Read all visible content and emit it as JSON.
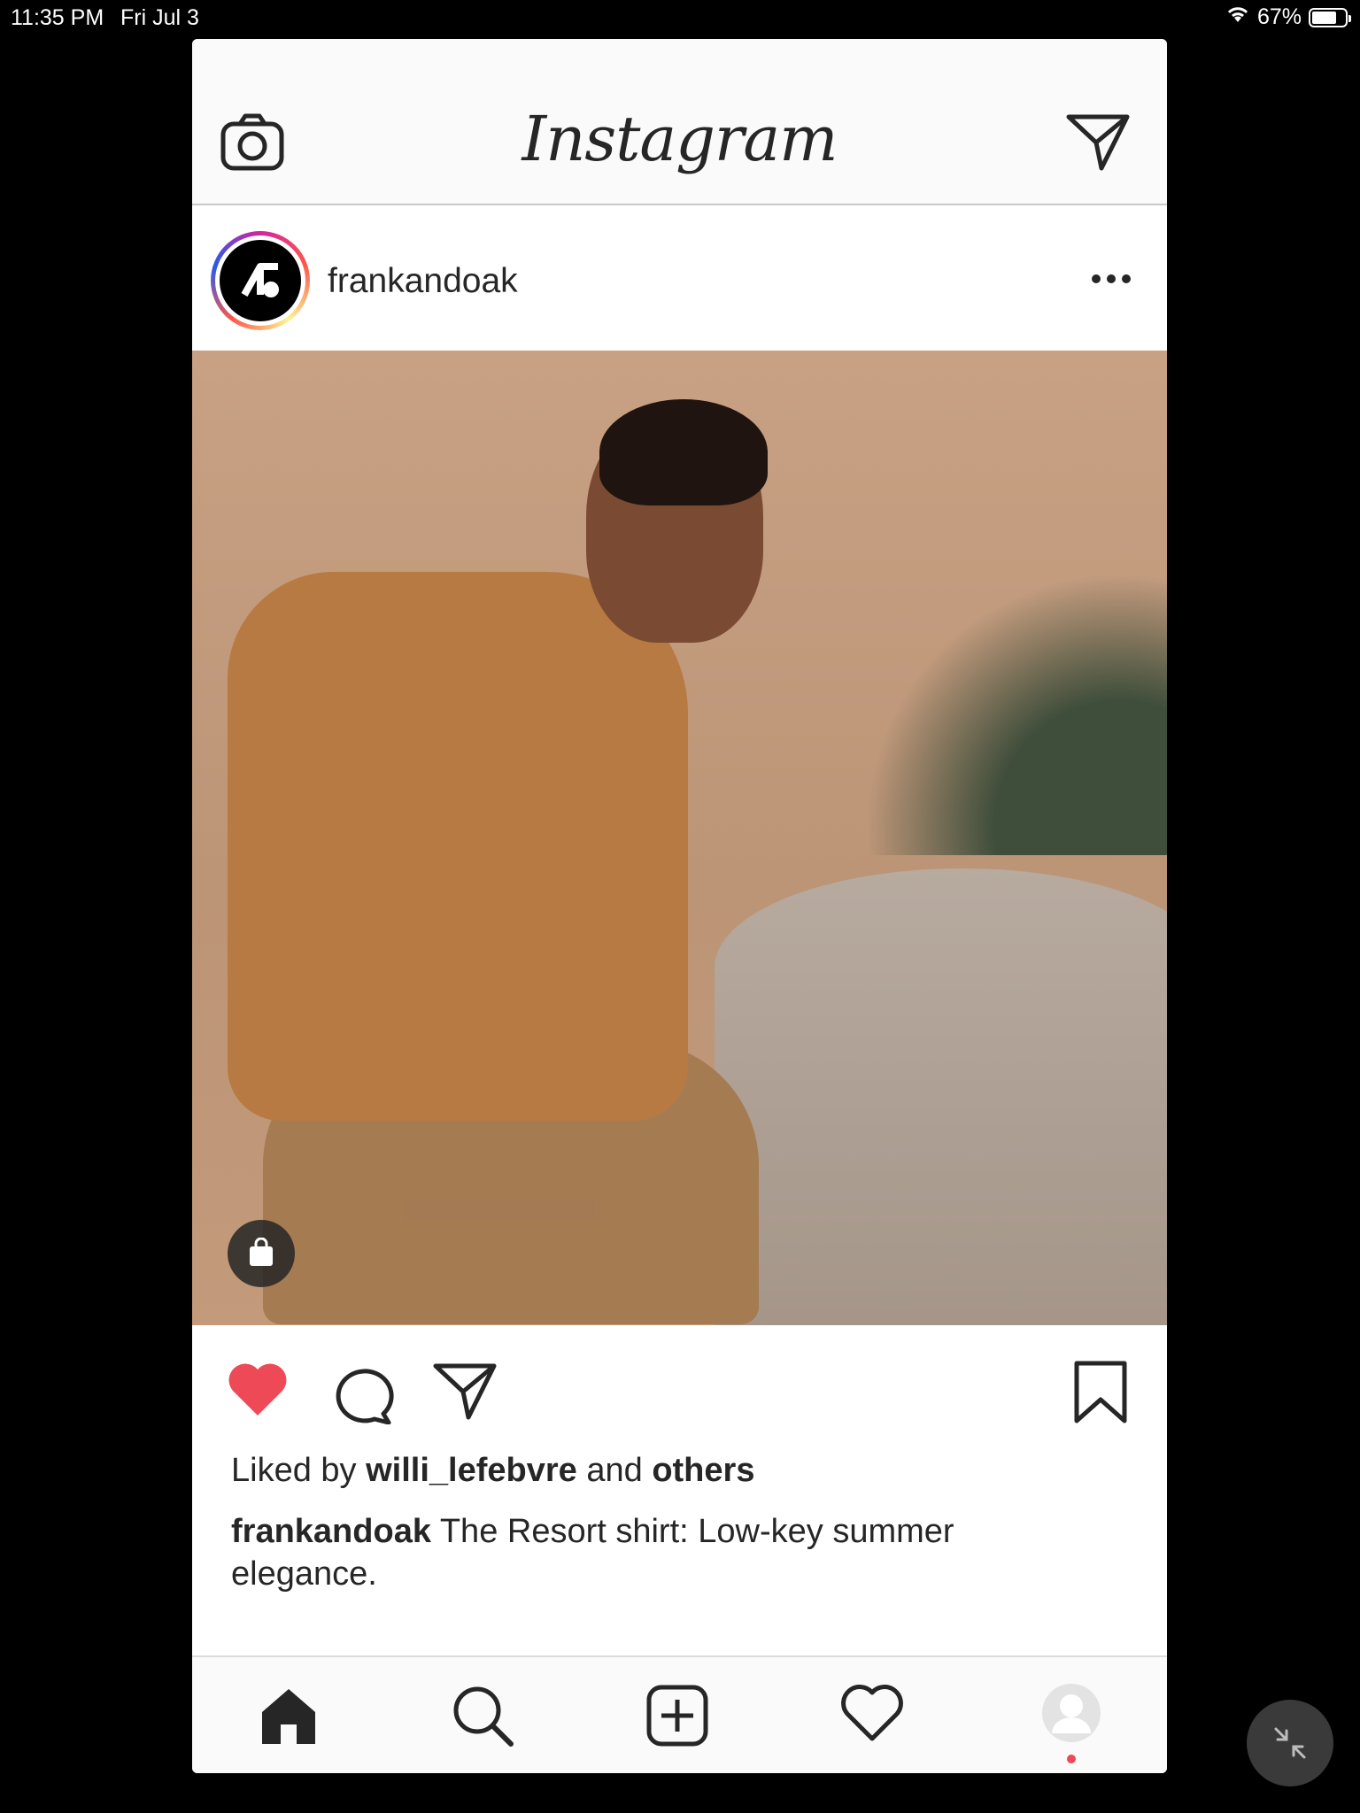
{
  "status_bar": {
    "time": "11:35 PM",
    "date": "Fri Jul 3",
    "battery_percent": "67%",
    "battery_level": 0.67,
    "wifi_icon": "wifi-icon"
  },
  "header": {
    "title": "Instagram",
    "left_icon": "camera-icon",
    "right_icon": "direct-message-icon"
  },
  "post": {
    "username": "frankandoak",
    "more_icon": "more-options-icon",
    "image_description_icon": "shopping-bag-icon",
    "liked_by_prefix": "Liked by",
    "liked_by_user": "willi_lefebvre",
    "liked_by_and": "and",
    "liked_by_others": "others",
    "caption_user": "frankandoak",
    "caption_text": "The Resort shirt: Low-key summer elegance.",
    "liked": true
  },
  "bottom_nav": {
    "items": [
      "home-icon",
      "search-icon",
      "add-post-icon",
      "activity-icon",
      "profile-icon"
    ],
    "has_notification_dot": true
  },
  "colors": {
    "like_red": "#ed4956",
    "text": "#262626"
  }
}
